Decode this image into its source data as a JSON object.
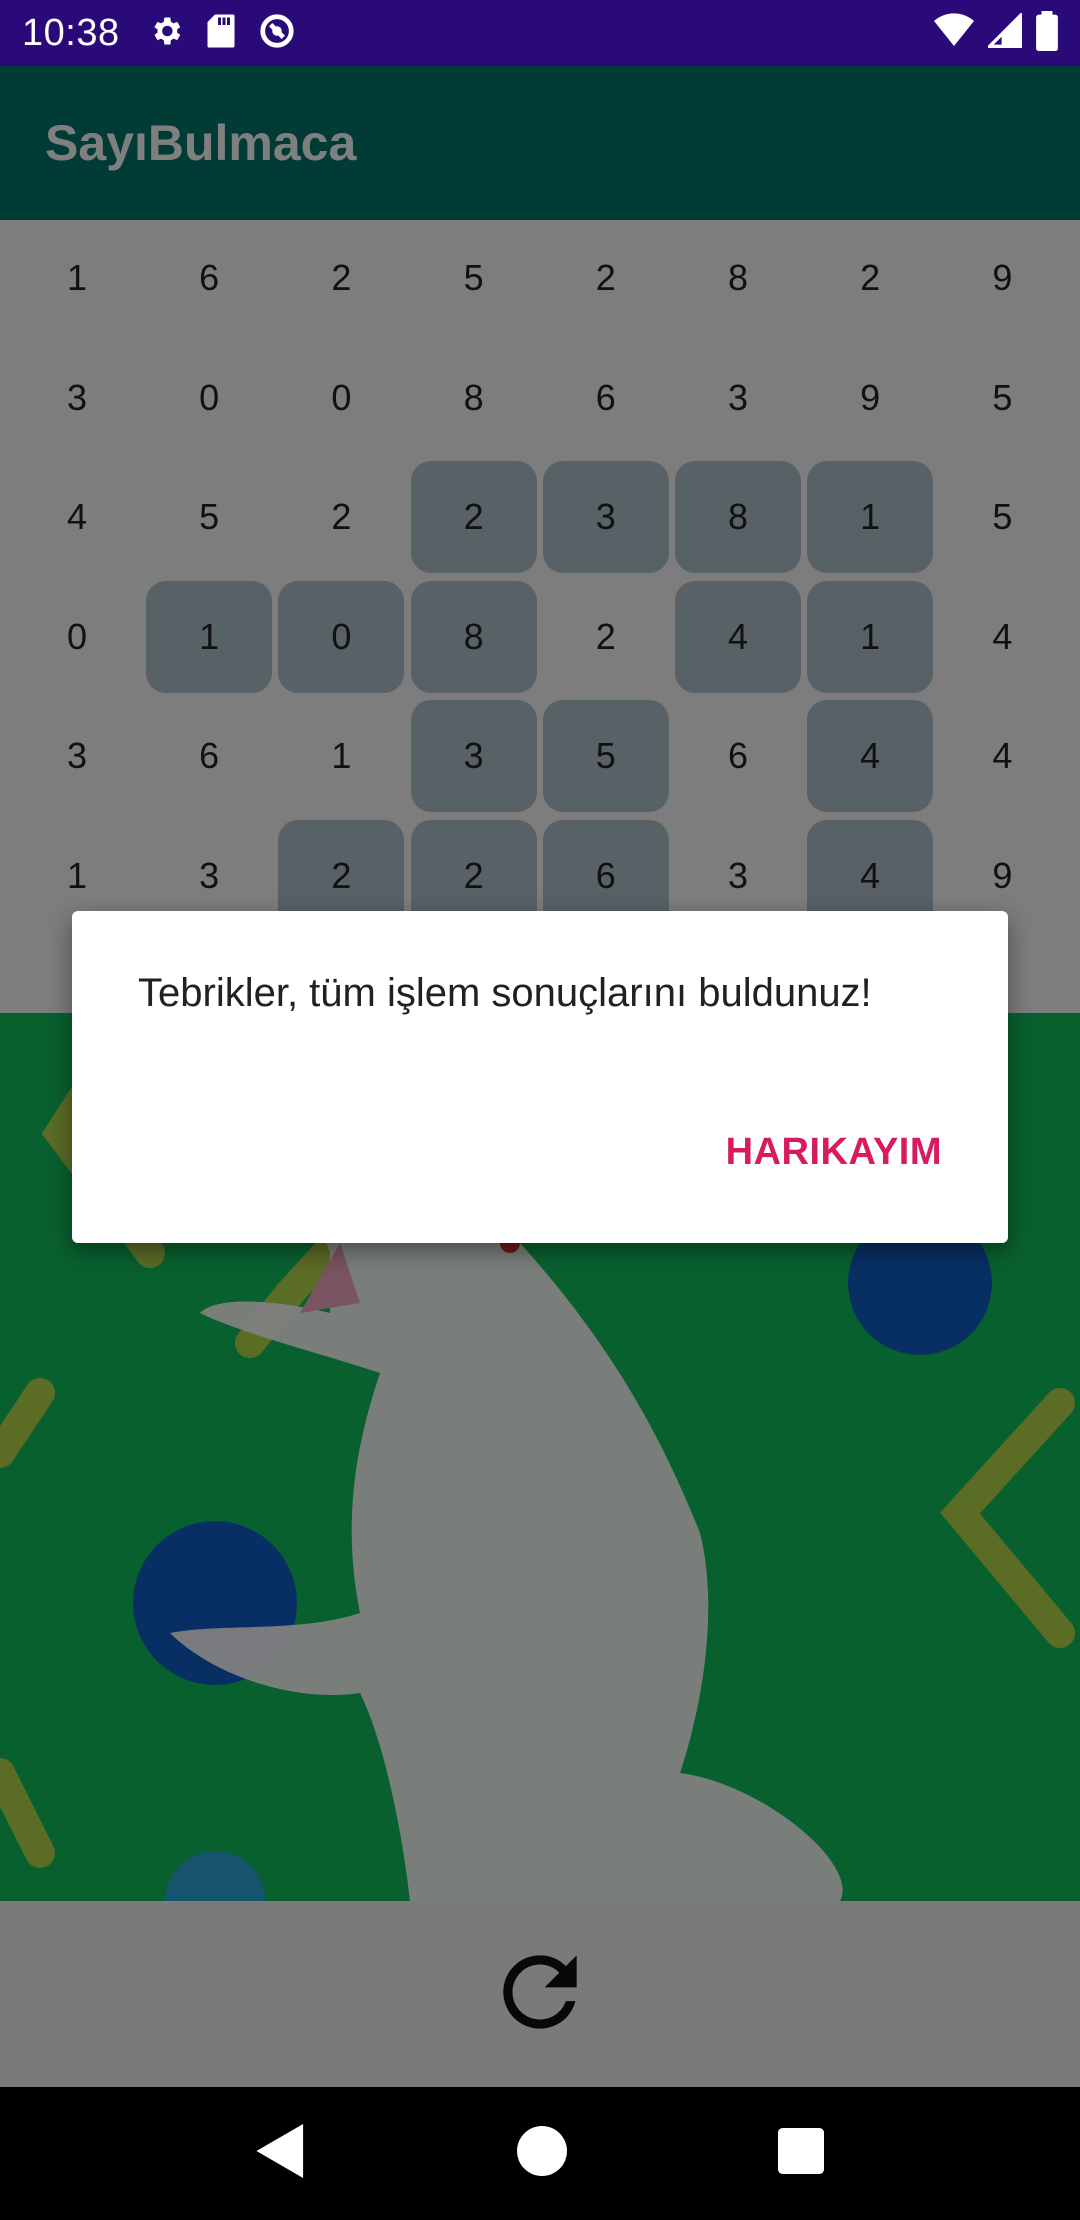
{
  "status_bar": {
    "time": "10:38",
    "left_icons": [
      "settings-icon",
      "sd-card-icon",
      "vpn-icon"
    ],
    "right_icons": [
      "wifi-icon",
      "signal-icon",
      "battery-icon"
    ],
    "background": "#2a0a78"
  },
  "app_bar": {
    "title": "SayıBulmaca",
    "color": "#00796b"
  },
  "grid": {
    "rows": [
      [
        "1",
        "6",
        "2",
        "5",
        "2",
        "8",
        "2",
        "9"
      ],
      [
        "3",
        "0",
        "0",
        "8",
        "6",
        "3",
        "9",
        "5"
      ],
      [
        "4",
        "5",
        "2",
        "2",
        "3",
        "8",
        "1",
        "5"
      ],
      [
        "0",
        "1",
        "0",
        "8",
        "2",
        "4",
        "1",
        "4"
      ],
      [
        "3",
        "6",
        "1",
        "3",
        "5",
        "6",
        "4",
        "4"
      ],
      [
        "1",
        "3",
        "2",
        "2",
        "6",
        "3",
        "4",
        "9"
      ]
    ],
    "selected": [
      [
        2,
        3
      ],
      [
        2,
        4
      ],
      [
        2,
        5
      ],
      [
        2,
        6
      ],
      [
        3,
        1
      ],
      [
        3,
        2
      ],
      [
        3,
        3
      ],
      [
        3,
        5
      ],
      [
        3,
        6
      ],
      [
        4,
        3
      ],
      [
        4,
        4
      ],
      [
        4,
        6
      ],
      [
        5,
        2
      ],
      [
        5,
        3
      ],
      [
        5,
        4
      ],
      [
        5,
        6
      ]
    ],
    "selected_color": "#b0c2cc"
  },
  "image": {
    "description_icon": "cat-illustration",
    "background": "#12c05e"
  },
  "action_bar": {
    "icon": "refresh-icon"
  },
  "nav_bar": {
    "icons": [
      "back-icon",
      "home-icon",
      "recents-icon"
    ]
  },
  "dialog": {
    "message": "Tebrikler, tüm işlem sonuçlarını buldunuz!",
    "positive_button": "HARIKAYIM",
    "button_color": "#d81b60"
  }
}
